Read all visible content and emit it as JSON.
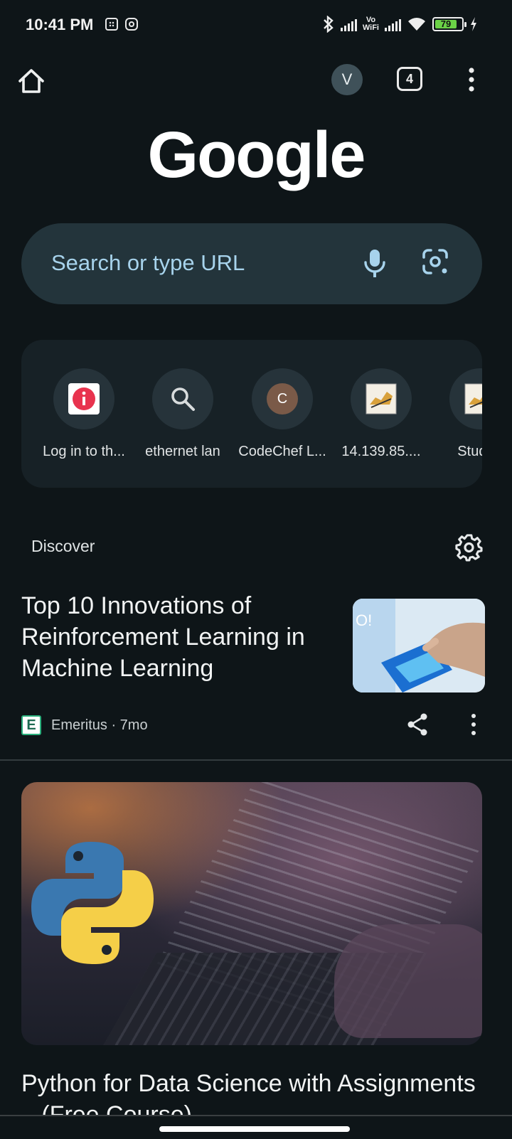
{
  "status_bar": {
    "time": "10:41 PM",
    "vowifi_top": "Vo",
    "vowifi_bottom": "WiFi",
    "battery_percent": "79",
    "icons": [
      "grid-notification-icon",
      "instagram-icon",
      "bluetooth-icon",
      "signal-icon",
      "vowifi-icon",
      "signal-icon",
      "wifi-icon",
      "battery-icon",
      "charging-icon"
    ]
  },
  "toolbar": {
    "account_initial": "V",
    "tab_count": "4",
    "icons": [
      "home-icon",
      "more-vert-icon"
    ]
  },
  "logo": {
    "text": "Google"
  },
  "search": {
    "placeholder": "Search or type URL",
    "icons": [
      "mic-icon",
      "google-lens-icon"
    ]
  },
  "shortcuts": [
    {
      "label": "Log in to th...",
      "icon": "red-info-icon"
    },
    {
      "label": "ethernet lan",
      "icon": "search-icon"
    },
    {
      "label": "CodeChef L...",
      "icon": "letter-avatar",
      "initial": "C"
    },
    {
      "label": "14.139.85....",
      "icon": "tomcat-icon"
    },
    {
      "label": "Studen",
      "icon": "tomcat-icon"
    }
  ],
  "discover": {
    "heading": "Discover",
    "articles": [
      {
        "title": "Top 10 Innovations of Reinforcement Learning in Machine Learning",
        "source": "Emeritus",
        "age": "7mo",
        "source_meta": "Emeritus · 7mo",
        "source_logo_letter": "E"
      },
      {
        "title": "Python for Data Science with Assignments – (Free Course)"
      }
    ]
  },
  "colors": {
    "background": "#0e1518",
    "search_bg": "#23343b",
    "placeholder": "#a7d3ec",
    "battery_fill": "#6bd247"
  }
}
